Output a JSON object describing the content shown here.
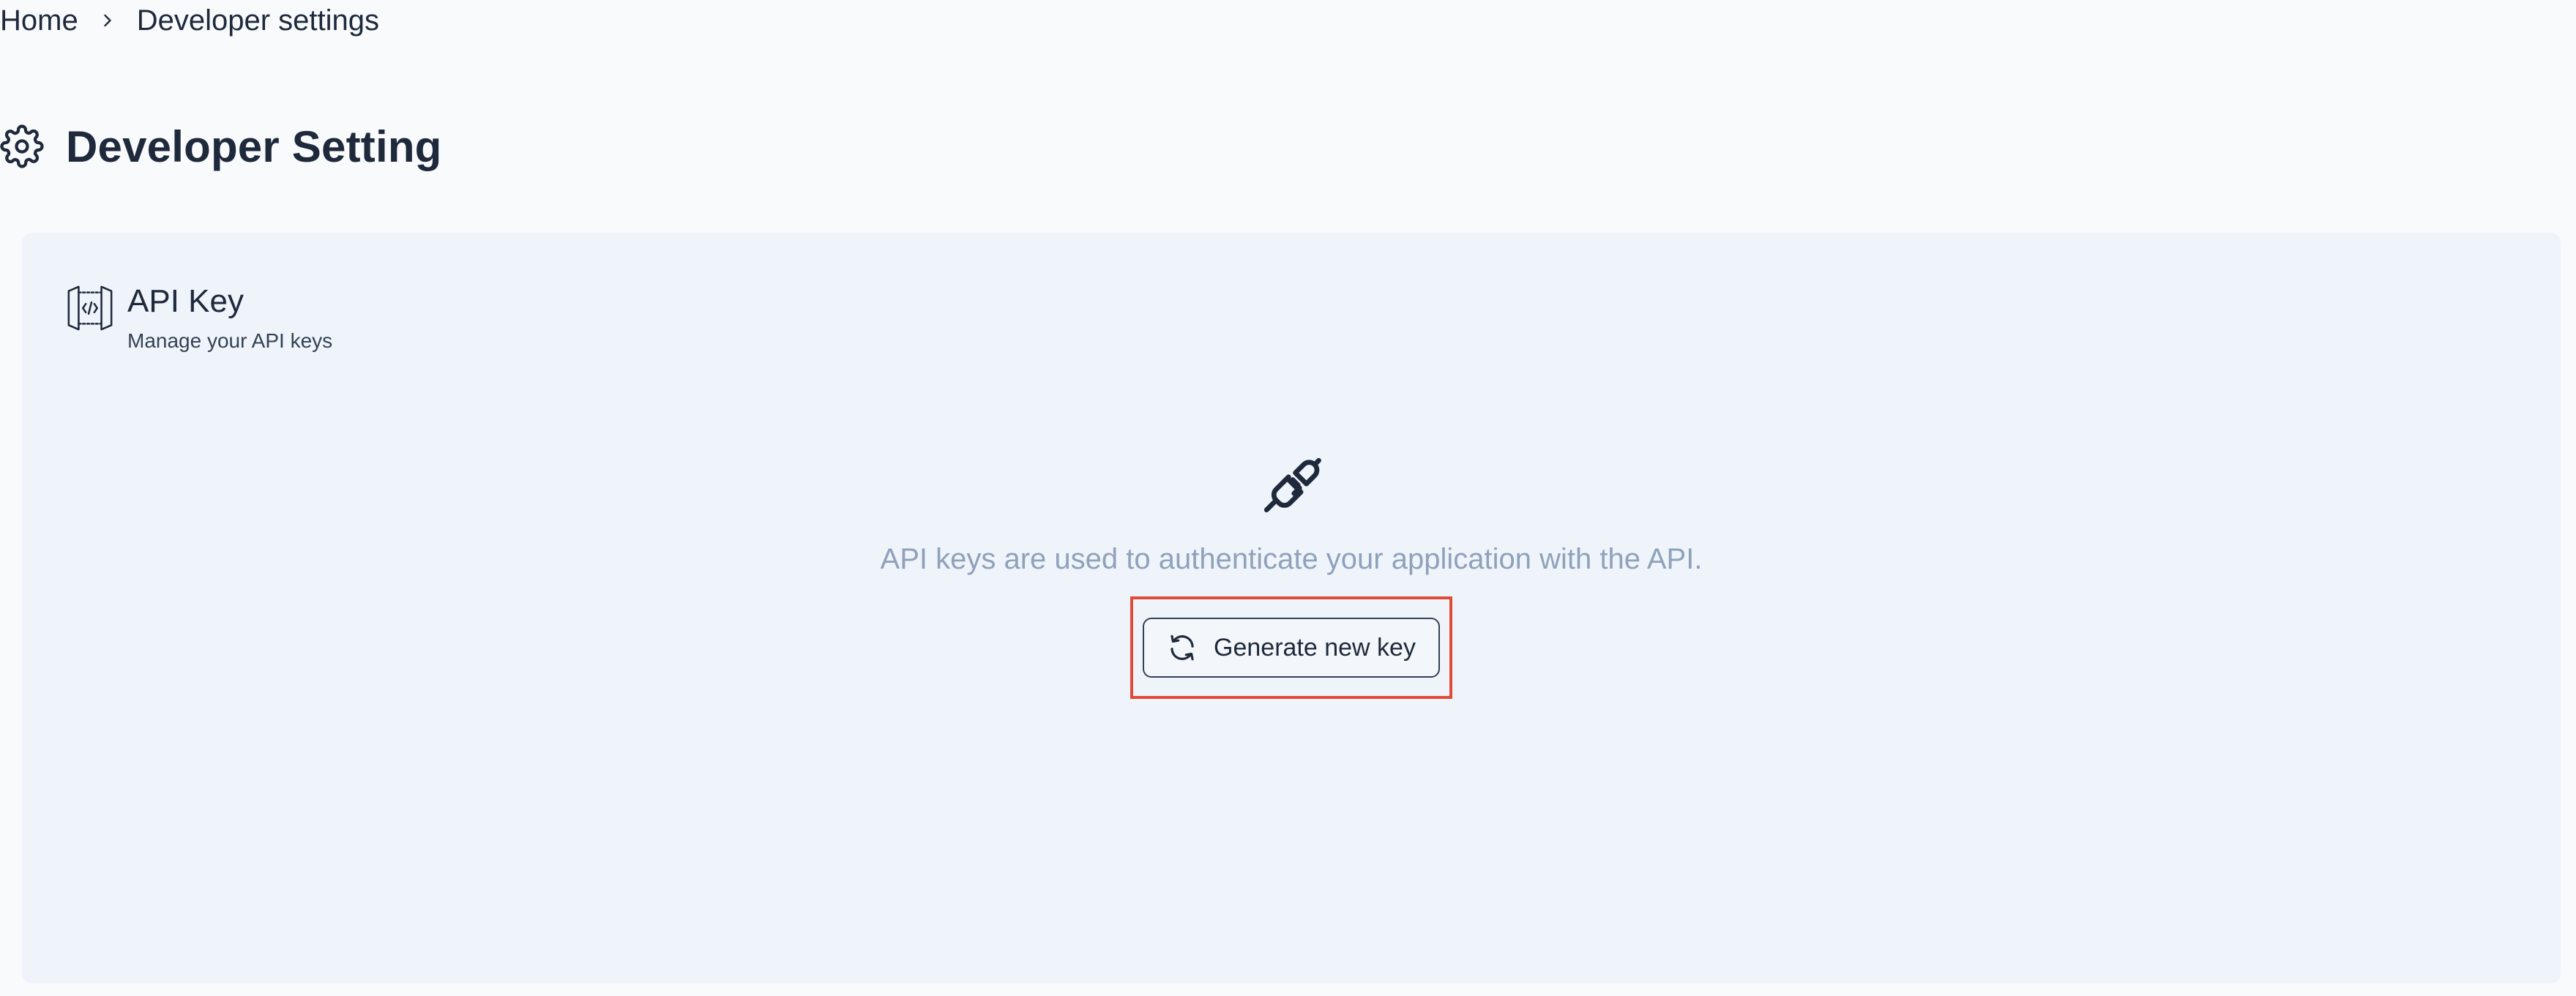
{
  "breadcrumb": {
    "home": "Home",
    "current": "Developer settings",
    "separator_icon": "chevron-right-icon"
  },
  "header": {
    "title": "Developer Setting",
    "icon": "gear-icon"
  },
  "api_key_card": {
    "title": "API Key",
    "subtitle": "Manage your API keys",
    "icon": "api-code-icon",
    "empty_state": {
      "icon": "plug-disconnected-icon",
      "message": "API keys are used to authenticate your application with the API.",
      "button_label": "Generate new key",
      "button_icon": "refresh-icon"
    }
  },
  "colors": {
    "page_bg": "#f8fafc",
    "card_bg": "#eff4fb",
    "text_primary": "#1e293b",
    "text_muted": "#8fa1bb",
    "highlight": "#e14a3b"
  }
}
